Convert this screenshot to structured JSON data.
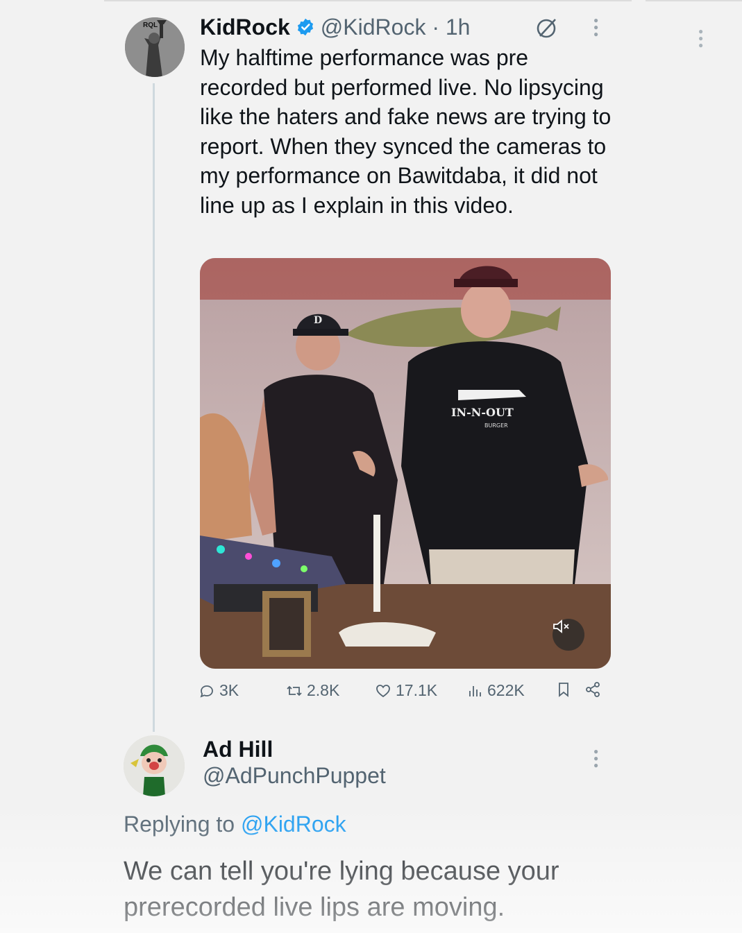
{
  "tweet": {
    "author_name": "KidRock",
    "handle_time": "@KidRock · 1h",
    "text": "My halftime performance was pre recorded but performed live. No lipsycing like the haters and fake news are trying to report. When they synced the cameras to my performance on Bawitdaba, it did not line up as I explain in this video.",
    "avatar_text": "RQL",
    "media_shirt_text": "IN-N-OUT",
    "media_shirt_subtext": "BURGER",
    "media_cap_letter": "D",
    "stats": {
      "replies": "3K",
      "reposts": "2.8K",
      "likes": "17.1K",
      "views": "622K"
    },
    "icons": {
      "verified": "verified-badge-icon",
      "grok": "grok-icon",
      "more": "more-vertical-icon",
      "mute": "volume-muted-icon",
      "reply": "reply-icon",
      "repost": "repost-icon",
      "like": "heart-icon",
      "views": "views-icon",
      "bookmark": "bookmark-icon",
      "share": "share-icon"
    }
  },
  "reply": {
    "author_name": "Ad Hill",
    "handle": "@AdPunchPuppet",
    "replying_prefix": "Replying to ",
    "replying_mention": "@KidRock",
    "text": "We can tell you're lying because your prerecorded live lips are moving."
  },
  "colors": {
    "accent": "#1d9bf0",
    "muted_text": "#536471",
    "thread_line": "#cfd9de"
  }
}
